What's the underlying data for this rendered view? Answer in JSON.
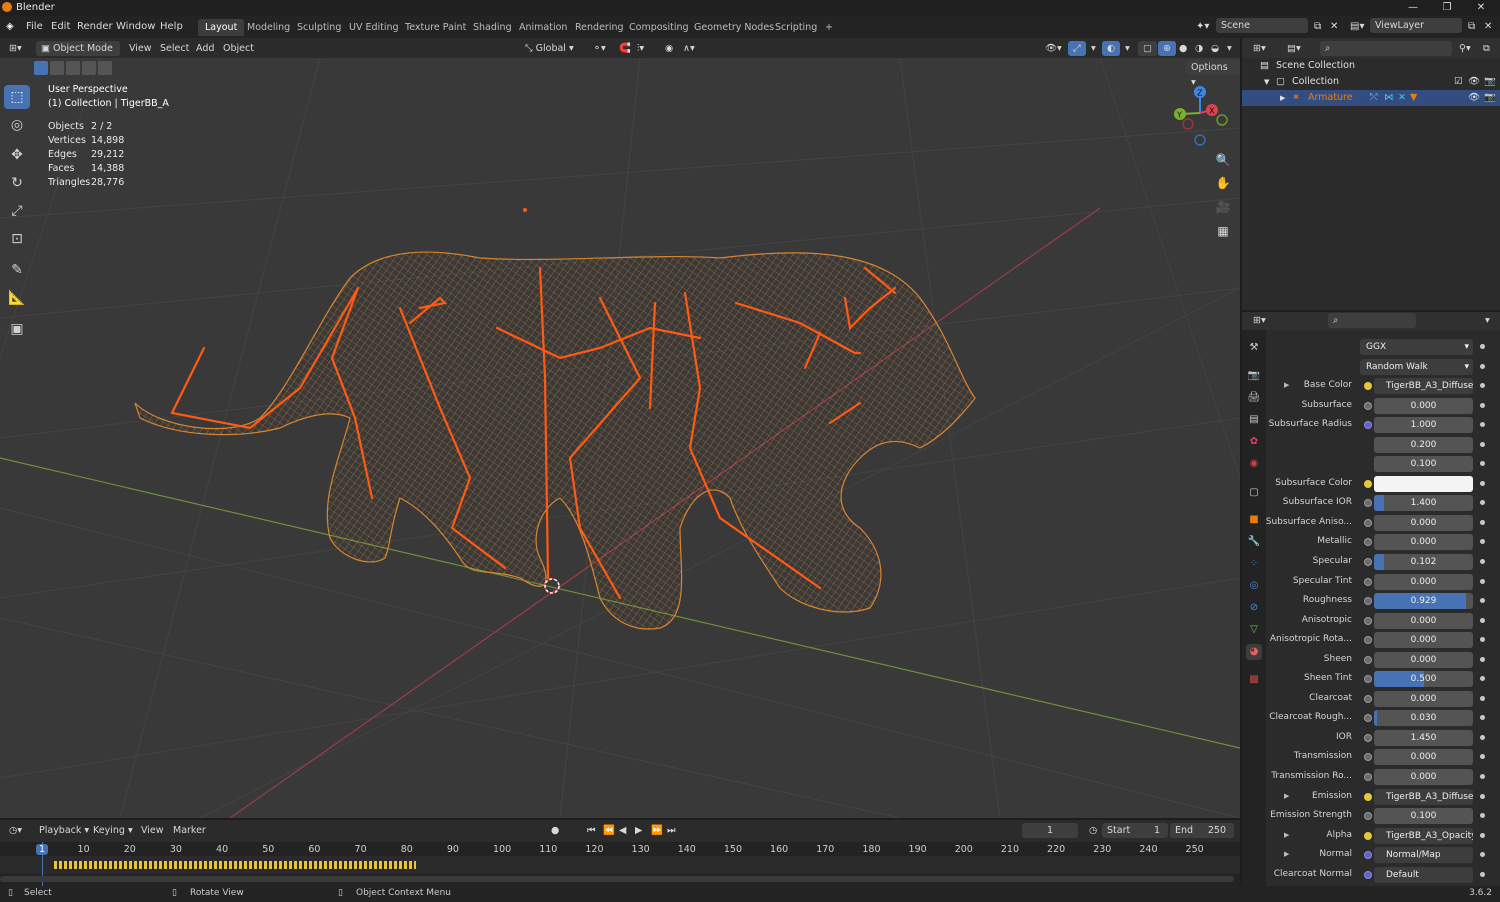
{
  "app": {
    "title": "Blender",
    "version": "3.6.2"
  },
  "menus": [
    "File",
    "Edit",
    "Render",
    "Window",
    "Help"
  ],
  "workspaces": [
    {
      "label": "Layout",
      "active": true
    },
    {
      "label": "Modeling"
    },
    {
      "label": "Sculpting"
    },
    {
      "label": "UV Editing"
    },
    {
      "label": "Texture Paint"
    },
    {
      "label": "Shading"
    },
    {
      "label": "Animation"
    },
    {
      "label": "Rendering"
    },
    {
      "label": "Compositing"
    },
    {
      "label": "Geometry Nodes"
    },
    {
      "label": "Scripting"
    }
  ],
  "scene": {
    "name": "Scene",
    "view_layer": "ViewLayer"
  },
  "viewport_header": {
    "mode": "Object Mode",
    "menus": [
      "View",
      "Select",
      "Add",
      "Object"
    ],
    "transform_orientation": "Global",
    "options_label": "Options"
  },
  "viewport": {
    "perspective": "User Perspective",
    "collection_line": "(1) Collection | TigerBB_A",
    "stats": [
      {
        "label": "Objects",
        "value": "2 / 2"
      },
      {
        "label": "Vertices",
        "value": "14,898"
      },
      {
        "label": "Edges",
        "value": "29,212"
      },
      {
        "label": "Faces",
        "value": "14,388"
      },
      {
        "label": "Triangles",
        "value": "28,776"
      }
    ],
    "gizmo_axes": {
      "x": "X",
      "y": "Y",
      "z": "Z"
    }
  },
  "outliner": {
    "rows": [
      {
        "label": "Scene Collection"
      },
      {
        "label": "Collection"
      },
      {
        "label": "Armature"
      }
    ]
  },
  "properties": {
    "distribution": "GGX",
    "subsurface_method": "Random Walk",
    "rows": [
      {
        "label": "Base Color",
        "type": "link",
        "value": "TigerBB_A3_Diffuse",
        "socket": "yel",
        "expand": true
      },
      {
        "label": "Subsurface",
        "type": "num",
        "value": "0.000",
        "fill": 0
      },
      {
        "label": "Subsurface Radius",
        "type": "num",
        "value": "1.000",
        "fill": 0,
        "socket": "purple"
      },
      {
        "label": "",
        "type": "num",
        "value": "0.200",
        "fill": 0,
        "nosocket": true
      },
      {
        "label": "",
        "type": "num",
        "value": "0.100",
        "fill": 0,
        "nosocket": true
      },
      {
        "label": "Subsurface Color",
        "type": "color",
        "value": "",
        "socket": "yel"
      },
      {
        "label": "Subsurface IOR",
        "type": "num",
        "value": "1.400",
        "fill": 0.1
      },
      {
        "label": "Subsurface Aniso...",
        "type": "num",
        "value": "0.000",
        "fill": 0
      },
      {
        "label": "Metallic",
        "type": "num",
        "value": "0.000",
        "fill": 0
      },
      {
        "label": "Specular",
        "type": "num",
        "value": "0.102",
        "fill": 0.102
      },
      {
        "label": "Specular Tint",
        "type": "num",
        "value": "0.000",
        "fill": 0
      },
      {
        "label": "Roughness",
        "type": "num",
        "value": "0.929",
        "fill": 0.929
      },
      {
        "label": "Anisotropic",
        "type": "num",
        "value": "0.000",
        "fill": 0
      },
      {
        "label": "Anisotropic Rota...",
        "type": "num",
        "value": "0.000",
        "fill": 0
      },
      {
        "label": "Sheen",
        "type": "num",
        "value": "0.000",
        "fill": 0
      },
      {
        "label": "Sheen Tint",
        "type": "num",
        "value": "0.500",
        "fill": 0.5
      },
      {
        "label": "Clearcoat",
        "type": "num",
        "value": "0.000",
        "fill": 0
      },
      {
        "label": "Clearcoat Rough...",
        "type": "num",
        "value": "0.030",
        "fill": 0.03
      },
      {
        "label": "IOR",
        "type": "num",
        "value": "1.450",
        "fill": 0
      },
      {
        "label": "Transmission",
        "type": "num",
        "value": "0.000",
        "fill": 0
      },
      {
        "label": "Transmission Ro...",
        "type": "num",
        "value": "0.000",
        "fill": 0
      },
      {
        "label": "Emission",
        "type": "link",
        "value": "TigerBB_A3_Diffuse",
        "socket": "yel",
        "expand": true
      },
      {
        "label": "Emission Strength",
        "type": "num",
        "value": "0.100",
        "fill": 0
      },
      {
        "label": "Alpha",
        "type": "link",
        "value": "TigerBB_A3_Opacity",
        "socket": "yel",
        "expand": true
      },
      {
        "label": "Normal",
        "type": "link",
        "value": "Normal/Map",
        "socket": "purple",
        "expand": true
      },
      {
        "label": "Clearcoat Normal",
        "type": "link",
        "value": "Default",
        "socket": "purple"
      }
    ]
  },
  "timeline": {
    "menus": [
      "Playback",
      "Keying",
      "View",
      "Marker"
    ],
    "current_frame": "1",
    "start_label": "Start",
    "start": "1",
    "end_label": "End",
    "end": "250",
    "ticks": [
      "1",
      "10",
      "20",
      "30",
      "40",
      "50",
      "60",
      "70",
      "80",
      "90",
      "100",
      "110",
      "120",
      "130",
      "140",
      "150",
      "160",
      "170",
      "180",
      "190",
      "200",
      "210",
      "220",
      "230",
      "240",
      "250"
    ]
  },
  "statusbar": {
    "items": [
      "Select",
      "Rotate View",
      "Object Context Menu"
    ]
  },
  "colors": {
    "accent": "#4772b3",
    "selection": "#e87d0d",
    "bone": "#ff5a14",
    "mesh": "#d88530"
  }
}
